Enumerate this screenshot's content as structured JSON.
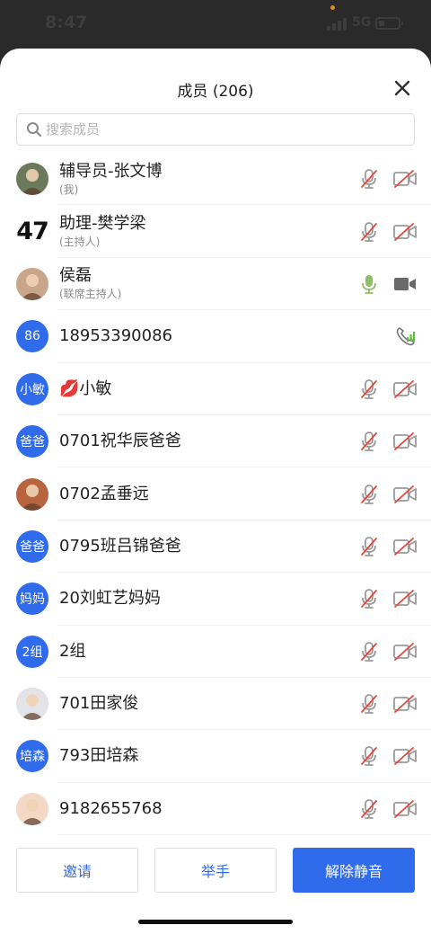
{
  "status_bar": {
    "time": "8:47",
    "network": "5G",
    "colors": {
      "dot": "#e08a2c"
    }
  },
  "header": {
    "title": "成员 (206)",
    "close_icon": "close-icon"
  },
  "search": {
    "placeholder": "搜索成员",
    "icon": "search-icon"
  },
  "members": [
    {
      "name": "辅导员-张文博",
      "role": "(我)",
      "avatar": {
        "kind": "photo",
        "text": ""
      },
      "mic": "muted",
      "camera": "off"
    },
    {
      "name": "助理-樊学梁",
      "role": "(主持人)",
      "avatar": {
        "kind": "number",
        "text": "47"
      },
      "mic": "muted",
      "camera": "off"
    },
    {
      "name": "侯磊",
      "role": "(联席主持人)",
      "avatar": {
        "kind": "photo",
        "text": ""
      },
      "mic": "on",
      "camera": "on"
    },
    {
      "name": "18953390086",
      "role": "",
      "avatar": {
        "kind": "blue",
        "text": "86"
      },
      "mic": "phone",
      "camera": "none"
    },
    {
      "name": "💋小敏",
      "role": "",
      "avatar": {
        "kind": "blue",
        "text": "小敏"
      },
      "mic": "muted",
      "camera": "off"
    },
    {
      "name": "0701祝华辰爸爸",
      "role": "",
      "avatar": {
        "kind": "blue",
        "text": "爸爸"
      },
      "mic": "muted",
      "camera": "off"
    },
    {
      "name": "0702孟垂远",
      "role": "",
      "avatar": {
        "kind": "photo",
        "text": ""
      },
      "mic": "muted",
      "camera": "off"
    },
    {
      "name": "0795班吕锦爸爸",
      "role": "",
      "avatar": {
        "kind": "blue",
        "text": "爸爸"
      },
      "mic": "muted",
      "camera": "off"
    },
    {
      "name": "20刘虹艺妈妈",
      "role": "",
      "avatar": {
        "kind": "blue",
        "text": "妈妈"
      },
      "mic": "muted",
      "camera": "off"
    },
    {
      "name": "2组",
      "role": "",
      "avatar": {
        "kind": "blue",
        "text": "2组"
      },
      "mic": "muted",
      "camera": "off"
    },
    {
      "name": "701田家俊",
      "role": "",
      "avatar": {
        "kind": "photo",
        "text": ""
      },
      "mic": "muted",
      "camera": "off"
    },
    {
      "name": "793田培森",
      "role": "",
      "avatar": {
        "kind": "blue",
        "text": "培森"
      },
      "mic": "muted",
      "camera": "off"
    },
    {
      "name": "9182655768",
      "role": "",
      "avatar": {
        "kind": "photo",
        "text": ""
      },
      "mic": "muted",
      "camera": "off"
    }
  ],
  "footer": {
    "invite_label": "邀请",
    "raise_hand_label": "举手",
    "unmute_label": "解除静音"
  },
  "colors": {
    "accent": "#2f6bea",
    "muted_icon": "#9a9a9a",
    "muted_slash": "#e6453a",
    "active_icon": "#6a6a6a",
    "mic_on": "#8fbf66",
    "phone": "#5fbf3b"
  }
}
